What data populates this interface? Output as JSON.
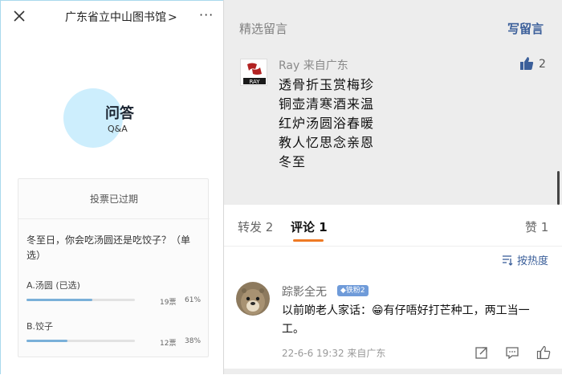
{
  "left": {
    "title": "广东省立中山图书馆",
    "title_chevron": ">",
    "more_icon_text": "···",
    "qa_title": "问答",
    "qa_sub": "Q&A",
    "vote": {
      "status": "投票已过期",
      "question": "冬至日，你会吃汤圆还是吃饺子？（单选）",
      "options": [
        {
          "label": "A.汤圆 (已选)",
          "votes": "19票",
          "pct": "61%",
          "fraction": 0.61
        },
        {
          "label": "B.饺子",
          "votes": "12票",
          "pct": "38%",
          "fraction": 0.38
        }
      ]
    }
  },
  "right": {
    "section_title": "精选留言",
    "write_button": "写留言",
    "featured": {
      "name": "Ray  来自广东",
      "like_count": "2",
      "lines": [
        "透骨折玉赏梅珍",
        "铜壶清寒酒来温",
        "红炉汤圆浴春暖",
        "教人忆思念亲恩",
        "冬至"
      ],
      "avatar_text": "RAY"
    },
    "tabs": {
      "forward": "转发 2",
      "comment": "评论 1",
      "like": "赞 1"
    },
    "sort_label": "按热度",
    "comment": {
      "name": "踪影全无",
      "badge": "铁粉2",
      "text": "以前啲老人家话：😁有仔唔好打芒种工，两工当一工。",
      "meta": "22-6-6 19:32  来自广东"
    }
  },
  "colors": {
    "accent_blue": "#3b5f9a",
    "tab_underline": "#ee7a25",
    "qa_circle": "#cdeefd",
    "bar_fill": "#7ab0d9",
    "badge": "#6f9bd9"
  }
}
